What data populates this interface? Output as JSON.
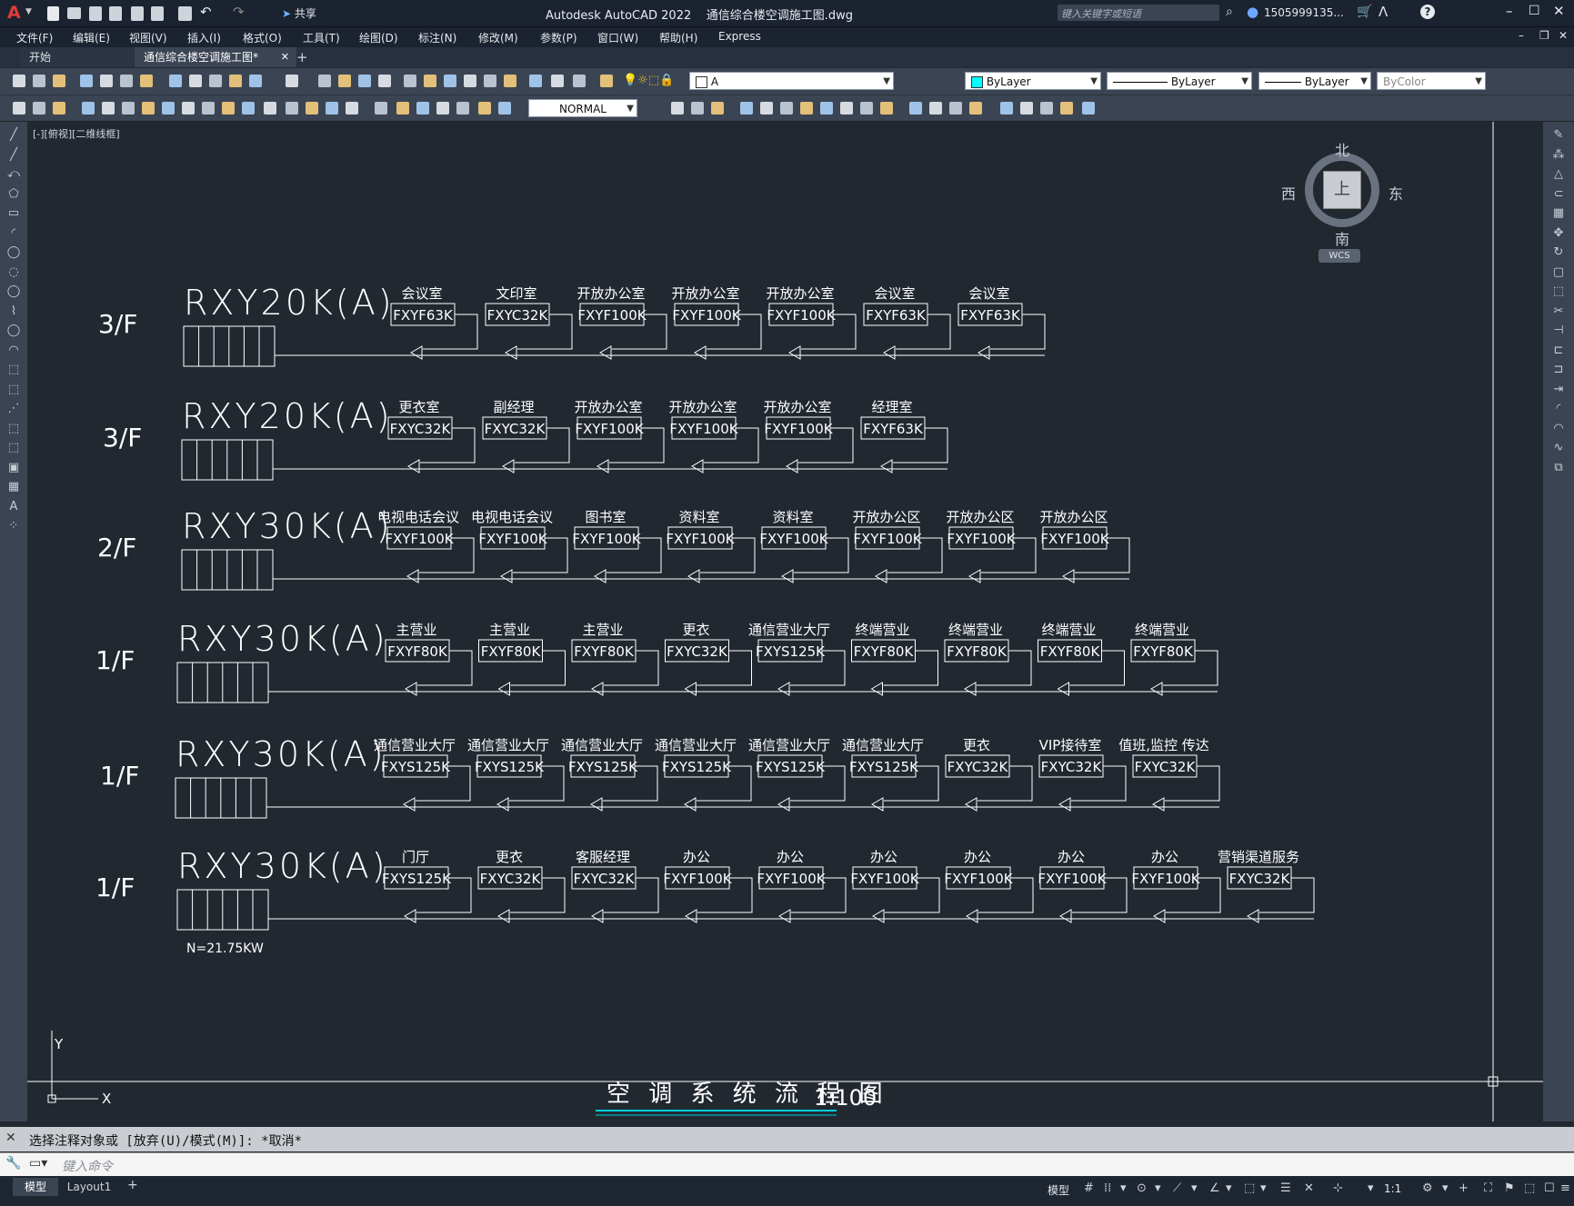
{
  "titlebar": {
    "app_title": "Autodesk AutoCAD 2022",
    "doc_title": "通信综合楼空调施工图.dwg",
    "share_label": "共享",
    "search_placeholder": "键入关键字或短语",
    "user": "1505999135...",
    "logo": "A"
  },
  "menu": [
    "文件(F)",
    "编辑(E)",
    "视图(V)",
    "插入(I)",
    "格式(O)",
    "工具(T)",
    "绘图(D)",
    "标注(N)",
    "修改(M)",
    "参数(P)",
    "窗口(W)",
    "帮助(H)",
    "Express"
  ],
  "tabs": {
    "start": "开始",
    "active": "通信综合楼空调施工图*",
    "close": "✕",
    "add": "+"
  },
  "toolbar": {
    "layer_value": "A",
    "color_value": "ByLayer",
    "linetype_value": "ByLayer",
    "lineweight_value": "ByLayer",
    "plotstyle_value": "ByColor",
    "dimstyle_value": "NORMAL"
  },
  "viewport": {
    "label": "[-][俯视][二维线框]"
  },
  "viewcube": {
    "north": "北",
    "south": "南",
    "east": "东",
    "west": "西",
    "top": "上",
    "wcs": "WCS"
  },
  "ucs": {
    "x": "X",
    "y": "Y"
  },
  "drawing": {
    "rows": [
      {
        "floor": "3/F",
        "model": "RXY20K(A)",
        "units": [
          [
            "会议室",
            "FXYF63K"
          ],
          [
            "文印室",
            "FXYC32K"
          ],
          [
            "开放办公室",
            "FXYF100K"
          ],
          [
            "开放办公室",
            "FXYF100K"
          ],
          [
            "开放办公室",
            "FXYF100K"
          ],
          [
            "会议室",
            "FXYF63K"
          ],
          [
            "会议室",
            "FXYF63K"
          ]
        ]
      },
      {
        "floor": "3/F",
        "model": "RXY20K(A)",
        "units": [
          [
            "更衣室",
            "FXYC32K"
          ],
          [
            "副经理",
            "FXYC32K"
          ],
          [
            "开放办公室",
            "FXYF100K"
          ],
          [
            "开放办公室",
            "FXYF100K"
          ],
          [
            "开放办公室",
            "FXYF100K"
          ],
          [
            "经理室",
            "FXYF63K"
          ]
        ]
      },
      {
        "floor": "2/F",
        "model": "RXY30K(A)",
        "units": [
          [
            "电视电话会议",
            "FXYF100K"
          ],
          [
            "电视电话会议",
            "FXYF100K"
          ],
          [
            "图书室",
            "FXYF100K"
          ],
          [
            "资料室",
            "FXYF100K"
          ],
          [
            "资料室",
            "FXYF100K"
          ],
          [
            "开放办公区",
            "FXYF100K"
          ],
          [
            "开放办公区",
            "FXYF100K"
          ],
          [
            "开放办公区",
            "FXYF100K"
          ]
        ]
      },
      {
        "floor": "1/F",
        "model": "RXY30K(A)",
        "units": [
          [
            "主营业",
            "FXYF80K"
          ],
          [
            "主营业",
            "FXYF80K"
          ],
          [
            "主营业",
            "FXYF80K"
          ],
          [
            "更衣",
            "FXYC32K"
          ],
          [
            "通信营业大厅",
            "FXYS125K"
          ],
          [
            "终端营业",
            "FXYF80K"
          ],
          [
            "终端营业",
            "FXYF80K"
          ],
          [
            "终端营业",
            "FXYF80K"
          ],
          [
            "终端营业",
            "FXYF80K"
          ]
        ]
      },
      {
        "floor": "1/F",
        "model": "RXY30K(A)",
        "units": [
          [
            "通信营业大厅",
            "FXYS125K"
          ],
          [
            "通信营业大厅",
            "FXYS125K"
          ],
          [
            "通信营业大厅",
            "FXYS125K"
          ],
          [
            "通信营业大厅",
            "FXYS125K"
          ],
          [
            "通信营业大厅",
            "FXYS125K"
          ],
          [
            "通信营业大厅",
            "FXYS125K"
          ],
          [
            "更衣",
            "FXYC32K"
          ],
          [
            "VIP接待室",
            "FXYC32K"
          ],
          [
            "值班,监控 传达",
            "FXYC32K"
          ]
        ]
      },
      {
        "floor": "1/F",
        "model": "RXY30K(A)",
        "note": "N=21.75KW",
        "units": [
          [
            "门厅",
            "FXYS125K"
          ],
          [
            "更衣",
            "FXYC32K"
          ],
          [
            "客服经理",
            "FXYC32K"
          ],
          [
            "办公",
            "FXYF100K"
          ],
          [
            "办公",
            "FXYF100K"
          ],
          [
            "办公",
            "FXYF100K"
          ],
          [
            "办公",
            "FXYF100K"
          ],
          [
            "办公",
            "FXYF100K"
          ],
          [
            "办公",
            "FXYF100K"
          ],
          [
            "营销渠道服务",
            "FXYC32K"
          ]
        ]
      }
    ],
    "title": "空 调 系 统 流 程 图",
    "scale": "1:100"
  },
  "command": {
    "history": "选择注释对象或 [放弃(U)/模式(M)]: *取消*",
    "placeholder": "键入命令"
  },
  "status": {
    "model_tab": "模型",
    "layout_tab": "Layout1",
    "model_label": "模型",
    "scale": "1:1"
  }
}
